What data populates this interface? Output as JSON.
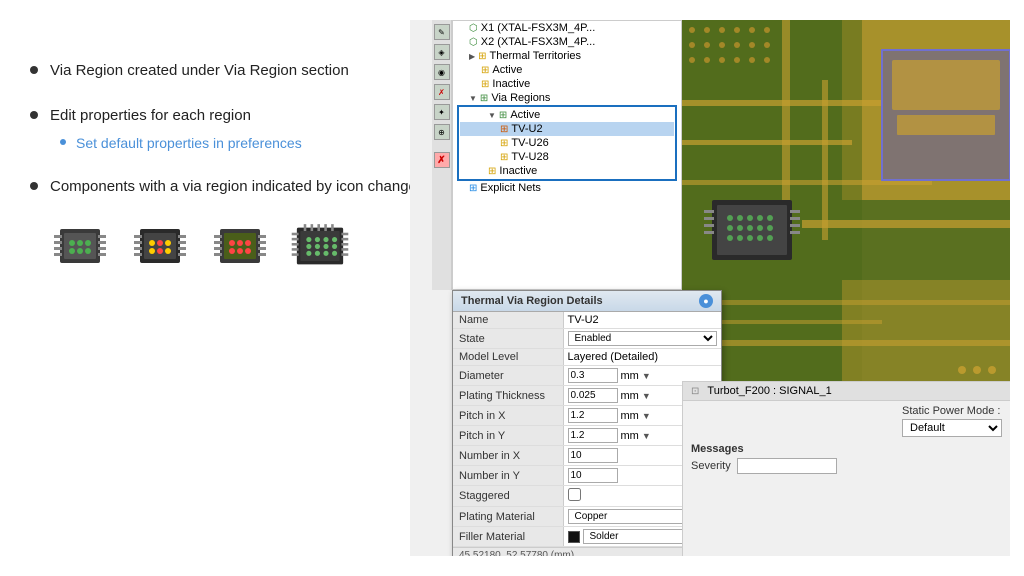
{
  "bullets": [
    {
      "id": "bullet1",
      "text": "Via Region created under Via Region section",
      "sub_bullets": []
    },
    {
      "id": "bullet2",
      "text": "Edit properties for each region",
      "sub_bullets": [
        {
          "id": "sub1",
          "text": "Set default properties in preferences"
        }
      ]
    },
    {
      "id": "bullet3",
      "text": "Components with a via region indicated by icon change",
      "sub_bullets": []
    }
  ],
  "tree": {
    "items": [
      {
        "id": "t1",
        "label": "X1 (XTAL-FSX3M_4P...",
        "indent": 1,
        "icon": "⬡",
        "icon_color": "icon-green",
        "selected": false
      },
      {
        "id": "t2",
        "label": "X2 (XTAL-FSX3M_4P...",
        "indent": 1,
        "icon": "⬡",
        "icon_color": "icon-green",
        "selected": false
      },
      {
        "id": "t3",
        "label": "Thermal Territories",
        "indent": 1,
        "icon": "▶",
        "selected": false
      },
      {
        "id": "t4",
        "label": "Active",
        "indent": 2,
        "icon": "⊞",
        "icon_color": "icon-yellow",
        "selected": false
      },
      {
        "id": "t5",
        "label": "Inactive",
        "indent": 2,
        "icon": "⊞",
        "icon_color": "icon-yellow",
        "selected": false
      },
      {
        "id": "t6",
        "label": "Via Regions",
        "indent": 1,
        "icon": "▼",
        "selected": false
      },
      {
        "id": "t7",
        "label": "Active",
        "indent": 2,
        "icon": "▼",
        "selected": false
      },
      {
        "id": "t8",
        "label": "TV-U2",
        "indent": 3,
        "icon": "⊞",
        "icon_color": "icon-orange",
        "selected": true
      },
      {
        "id": "t9",
        "label": "TV-U26",
        "indent": 3,
        "icon": "⊞",
        "icon_color": "icon-yellow",
        "selected": false
      },
      {
        "id": "t10",
        "label": "TV-U28",
        "indent": 3,
        "icon": "⊞",
        "icon_color": "icon-yellow",
        "selected": false
      },
      {
        "id": "t11",
        "label": "Inactive",
        "indent": 2,
        "icon": "⊞",
        "icon_color": "icon-yellow",
        "selected": false
      },
      {
        "id": "t12",
        "label": "Explicit Nets",
        "indent": 1,
        "icon": "⊞",
        "icon_color": "icon-blue",
        "selected": false
      }
    ]
  },
  "dialog": {
    "title": "Thermal Via Region Details",
    "fields": [
      {
        "label": "Name",
        "value": "TV-U2",
        "type": "text"
      },
      {
        "label": "State",
        "value": "Enabled",
        "type": "select"
      },
      {
        "label": "Model Level",
        "value": "Layered (Detailed)",
        "type": "text"
      },
      {
        "label": "Diameter",
        "value": "0.3",
        "unit": "mm",
        "type": "text_unit"
      },
      {
        "label": "Plating Thickness",
        "value": "0.025",
        "unit": "mm",
        "type": "text_unit"
      },
      {
        "label": "Pitch in X",
        "value": "1.2",
        "unit": "mm",
        "type": "text_unit"
      },
      {
        "label": "Pitch in Y",
        "value": "1.2",
        "unit": "mm",
        "type": "text_unit"
      },
      {
        "label": "Number in X",
        "value": "10",
        "type": "text"
      },
      {
        "label": "Number in Y",
        "value": "10",
        "type": "text"
      },
      {
        "label": "Staggered",
        "value": "",
        "type": "checkbox"
      },
      {
        "label": "Plating Material",
        "value": "Copper",
        "type": "select"
      },
      {
        "label": "Filler Material",
        "value": "Solder",
        "type": "select_color",
        "color": "#111"
      }
    ],
    "footer": "45.52180, 52.57780 (mm)"
  },
  "bottom": {
    "signal_label": "Turbot_F200 : SIGNAL_1",
    "static_power_label": "Static Power Mode :",
    "static_power_value": "Default",
    "messages_label": "Messages",
    "severity_label": "Severity"
  },
  "toolbar_buttons": [
    "✎",
    "◈",
    "◉",
    "✦",
    "✗"
  ]
}
